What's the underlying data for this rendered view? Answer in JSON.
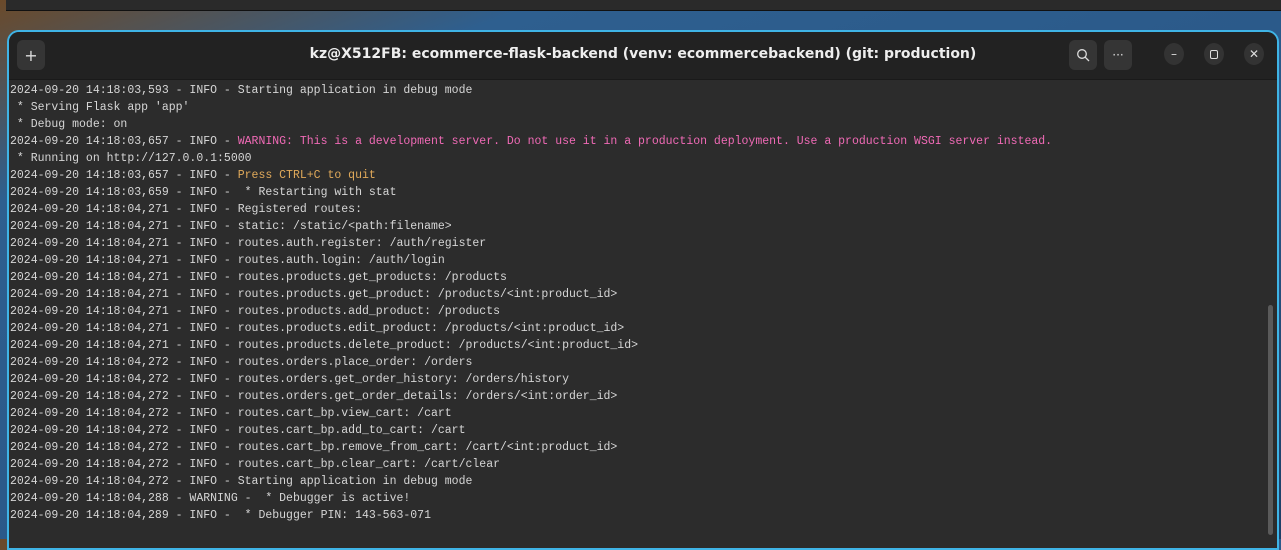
{
  "window": {
    "title": "kz@X512FB: ecommerce-flask-backend (venv: ecommercebackend) (git: production)"
  },
  "colors": {
    "accent": "#3fb4e6",
    "default": "#d6d6d6",
    "warning": "#f06ab6",
    "notice": "#e0a95a"
  },
  "lines": [
    {
      "prefix": "2024-09-20 14:18:03,593 - INFO - ",
      "text": "Starting application in debug mode",
      "kind": "default"
    },
    {
      "prefix": "",
      "text": " * Serving Flask app 'app'",
      "kind": "default"
    },
    {
      "prefix": "",
      "text": " * Debug mode: on",
      "kind": "default"
    },
    {
      "prefix": "2024-09-20 14:18:03,657 - INFO - ",
      "text": "WARNING: This is a development server. Do not use it in a production deployment. Use a production WSGI server instead.",
      "kind": "warning"
    },
    {
      "prefix": "",
      "text": " * Running on http://127.0.0.1:5000",
      "kind": "default"
    },
    {
      "prefix": "2024-09-20 14:18:03,657 - INFO - ",
      "text": "Press CTRL+C to quit",
      "kind": "notice"
    },
    {
      "prefix": "2024-09-20 14:18:03,659 - INFO - ",
      "text": " * Restarting with stat",
      "kind": "default"
    },
    {
      "prefix": "2024-09-20 14:18:04,271 - INFO - ",
      "text": "Registered routes:",
      "kind": "default"
    },
    {
      "prefix": "2024-09-20 14:18:04,271 - INFO - ",
      "text": "static: /static/<path:filename>",
      "kind": "default"
    },
    {
      "prefix": "2024-09-20 14:18:04,271 - INFO - ",
      "text": "routes.auth.register: /auth/register",
      "kind": "default"
    },
    {
      "prefix": "2024-09-20 14:18:04,271 - INFO - ",
      "text": "routes.auth.login: /auth/login",
      "kind": "default"
    },
    {
      "prefix": "2024-09-20 14:18:04,271 - INFO - ",
      "text": "routes.products.get_products: /products",
      "kind": "default"
    },
    {
      "prefix": "2024-09-20 14:18:04,271 - INFO - ",
      "text": "routes.products.get_product: /products/<int:product_id>",
      "kind": "default"
    },
    {
      "prefix": "2024-09-20 14:18:04,271 - INFO - ",
      "text": "routes.products.add_product: /products",
      "kind": "default"
    },
    {
      "prefix": "2024-09-20 14:18:04,271 - INFO - ",
      "text": "routes.products.edit_product: /products/<int:product_id>",
      "kind": "default"
    },
    {
      "prefix": "2024-09-20 14:18:04,271 - INFO - ",
      "text": "routes.products.delete_product: /products/<int:product_id>",
      "kind": "default"
    },
    {
      "prefix": "2024-09-20 14:18:04,272 - INFO - ",
      "text": "routes.orders.place_order: /orders",
      "kind": "default"
    },
    {
      "prefix": "2024-09-20 14:18:04,272 - INFO - ",
      "text": "routes.orders.get_order_history: /orders/history",
      "kind": "default"
    },
    {
      "prefix": "2024-09-20 14:18:04,272 - INFO - ",
      "text": "routes.orders.get_order_details: /orders/<int:order_id>",
      "kind": "default"
    },
    {
      "prefix": "2024-09-20 14:18:04,272 - INFO - ",
      "text": "routes.cart_bp.view_cart: /cart",
      "kind": "default"
    },
    {
      "prefix": "2024-09-20 14:18:04,272 - INFO - ",
      "text": "routes.cart_bp.add_to_cart: /cart",
      "kind": "default"
    },
    {
      "prefix": "2024-09-20 14:18:04,272 - INFO - ",
      "text": "routes.cart_bp.remove_from_cart: /cart/<int:product_id>",
      "kind": "default"
    },
    {
      "prefix": "2024-09-20 14:18:04,272 - INFO - ",
      "text": "routes.cart_bp.clear_cart: /cart/clear",
      "kind": "default"
    },
    {
      "prefix": "2024-09-20 14:18:04,272 - INFO - ",
      "text": "Starting application in debug mode",
      "kind": "default"
    },
    {
      "prefix": "2024-09-20 14:18:04,288 - WARNING - ",
      "text": " * Debugger is active!",
      "kind": "default"
    },
    {
      "prefix": "2024-09-20 14:18:04,289 - INFO - ",
      "text": " * Debugger PIN: 143-563-071",
      "kind": "default"
    }
  ]
}
